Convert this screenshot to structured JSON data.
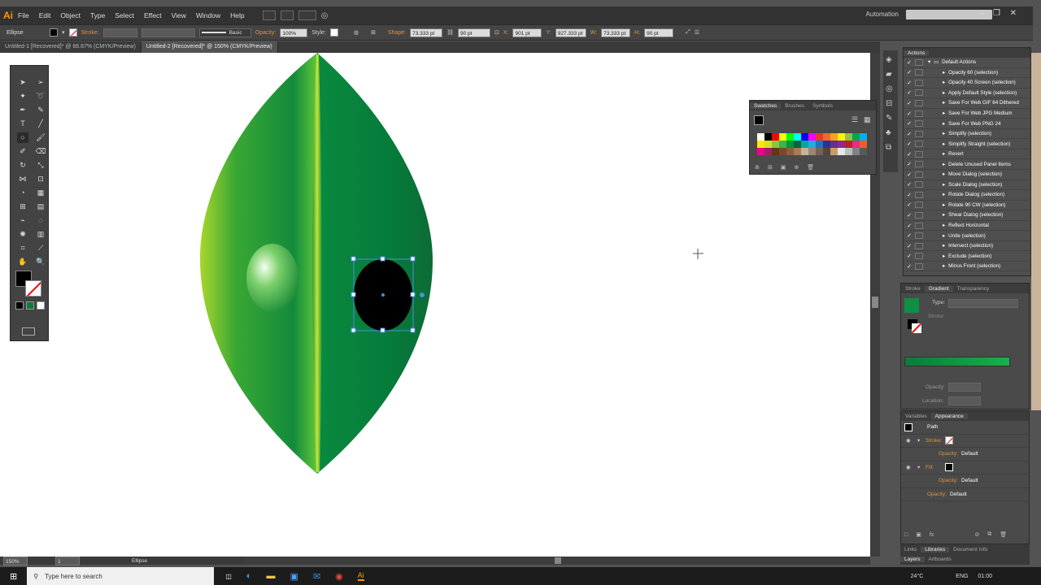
{
  "app": {
    "logo": "Ai",
    "automation": "Automation"
  },
  "menu": [
    "File",
    "Edit",
    "Object",
    "Type",
    "Select",
    "Effect",
    "View",
    "Window",
    "Help"
  ],
  "control_bar": {
    "selection_type": "Ellipse",
    "stroke_label": "Stroke:",
    "brush_label": "Basic",
    "opacity_label": "Opacity:",
    "opacity_value": "100%",
    "style_label": "Style:",
    "shape_label": "Shape:",
    "shape_w": "73.333 pt",
    "shape_h": "90 pt",
    "x_label": "X:",
    "x_value": "901 pt",
    "y_label": "Y:",
    "y_value": "927.333 pt",
    "w_label": "W:",
    "w_value": "73.333 pt",
    "h_label": "H:",
    "h_value": "90 pt"
  },
  "tabs": [
    {
      "label": "Untitled-1 [Recovered]* @ 66.67% (CMYK/Preview)",
      "active": false
    },
    {
      "label": "Untitled-2 [Recovered]* @ 150% (CMYK/Preview)",
      "active": true
    }
  ],
  "status": {
    "zoom": "150%",
    "page": "1",
    "tool": "Ellipse"
  },
  "swatches_panel": {
    "tabs": [
      "Swatches",
      "Brushes",
      "Symbols"
    ],
    "colors": [
      "#ffffff",
      "#000000",
      "#ff0000",
      "#ffff00",
      "#00ff00",
      "#00ffff",
      "#0000ff",
      "#ff00ff",
      "#e8382a",
      "#ee6c2b",
      "#f7a21b",
      "#fff200",
      "#8dc63f",
      "#00a651",
      "#00aeef",
      "#ffe600",
      "#d7df23",
      "#8cc63e",
      "#39b54a",
      "#009444",
      "#006837",
      "#00a99d",
      "#27aae1",
      "#1c75bc",
      "#2e3192",
      "#662d91",
      "#92278f",
      "#be1e2d",
      "#ee2a7b",
      "#f15a29",
      "#ec008c",
      "#9e1f63",
      "#603913",
      "#754c29",
      "#8b5e3c",
      "#a97c50",
      "#c7b299",
      "#998675",
      "#736357",
      "#534741",
      "#c69c6d",
      "#e6e7e8",
      "#bcbec0",
      "#808285",
      "#58595b"
    ]
  },
  "actions_panel": {
    "title": "Actions",
    "items": [
      "Default Actions",
      "Opacity 60 (selection)",
      "Opacity 40 Screen (selection)",
      "Apply Default Style (selection)",
      "Save For Web GIF 64 Dithered",
      "Save For Web JPG Medium",
      "Save For Web PNG 24",
      "Simplify (selection)",
      "Simplify Straight (selection)",
      "Revert",
      "Delete Unused Panel Items",
      "Move Dialog (selection)",
      "Scale Dialog (selection)",
      "Rotate Dialog (selection)",
      "Rotate 90 CW (selection)",
      "Shear Dialog (selection)",
      "Reflect Horizontal",
      "Unite (selection)",
      "Intersect (selection)",
      "Exclude (selection)",
      "Minus Front (selection)"
    ]
  },
  "gradient_panel": {
    "tabs": [
      "Stroke",
      "Gradient",
      "Transparency"
    ],
    "type_label": "Type:",
    "stroke_label": "Stroke:",
    "opacity_label": "Opacity:",
    "location_label": "Location:",
    "colors": {
      "start": "#0b7a3a",
      "end": "#17b24a",
      "swatch": "#0f8f44"
    }
  },
  "appearance_panel": {
    "tabs": [
      "Variables",
      "Appearance"
    ],
    "path": "Path",
    "stroke": "Stroke:",
    "fill": "Fill:",
    "opacity": "Opacity:",
    "default": "Default"
  },
  "bottom_tabs": [
    "Links",
    "Libraries",
    "Document Info"
  ],
  "bottom_tabs2": [
    "Layers",
    "Artboards"
  ],
  "taskbar": {
    "search": "Type here to search",
    "time": "01:00",
    "lang": "ENG",
    "temp": "24°C"
  }
}
